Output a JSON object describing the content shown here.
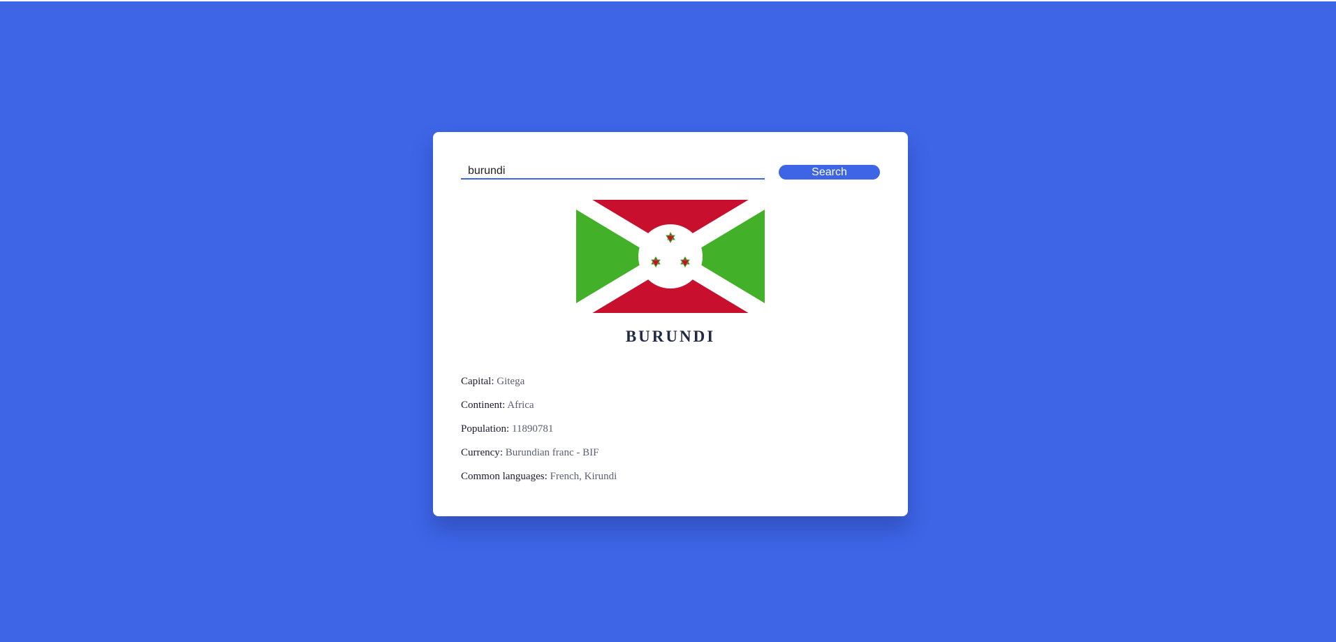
{
  "search": {
    "value": "burundi",
    "button_label": "Search"
  },
  "country": {
    "name": "BURUNDI",
    "flag_colors": {
      "red": "#c8102e",
      "green": "#43b02a",
      "white": "#ffffff"
    }
  },
  "details": [
    {
      "label": "Capital",
      "value": "Gitega"
    },
    {
      "label": "Continent",
      "value": "Africa"
    },
    {
      "label": "Population",
      "value": "11890781"
    },
    {
      "label": "Currency",
      "value": "Burundian franc - BIF"
    },
    {
      "label": "Common languages",
      "value": "French, Kirundi"
    }
  ],
  "colors": {
    "background": "#3d65e6",
    "card": "#ffffff",
    "accent": "#3d65e6"
  }
}
